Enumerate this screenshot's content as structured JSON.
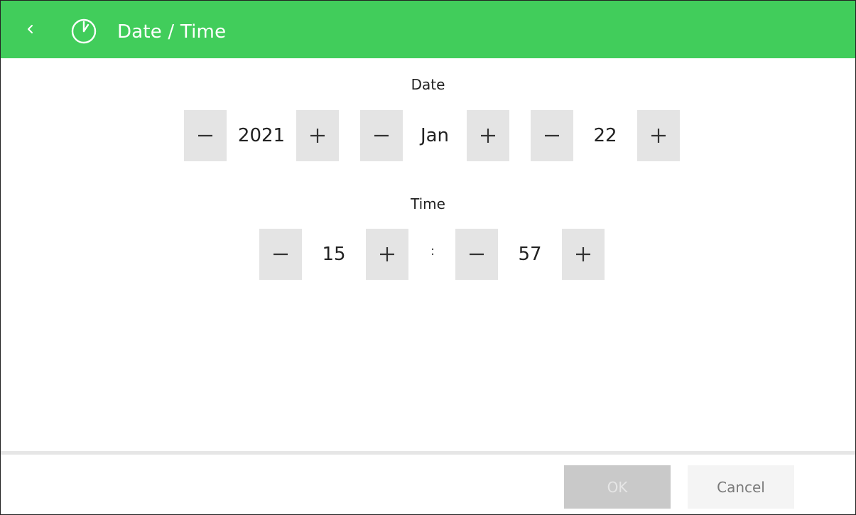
{
  "header": {
    "title": "Date / Time",
    "color": "#41cd5b",
    "back_icon": "chevron-left-icon",
    "clock_icon": "clock-icon"
  },
  "date": {
    "label": "Date",
    "year": "2021",
    "month": "Jan",
    "day": "22"
  },
  "time": {
    "label": "Time",
    "hour": "15",
    "separator": ":",
    "minute": "57"
  },
  "footer": {
    "ok_label": "OK",
    "cancel_label": "Cancel"
  }
}
